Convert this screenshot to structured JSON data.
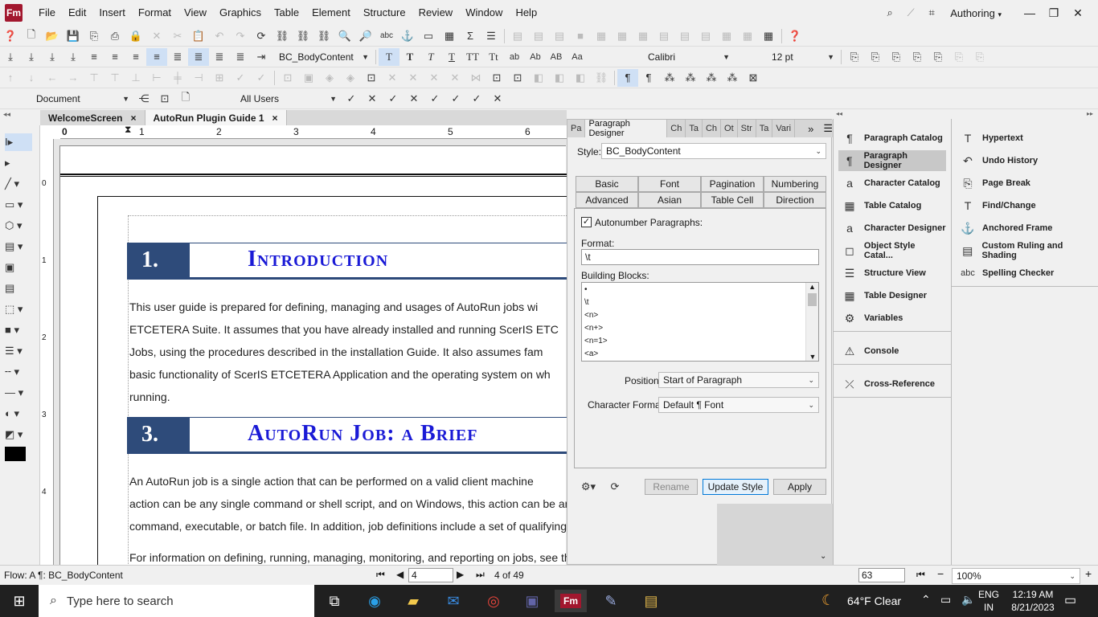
{
  "app": {
    "logo": "Fm",
    "workspace": "Authoring"
  },
  "menu": [
    "File",
    "Edit",
    "Insert",
    "Format",
    "View",
    "Graphics",
    "Table",
    "Element",
    "Structure",
    "Review",
    "Window",
    "Help"
  ],
  "format_toolbar": {
    "paragraph_style": "BC_BodyContent",
    "font": "Calibri",
    "size": "12 pt"
  },
  "track_toolbar": {
    "view": "Document",
    "users": "All Users"
  },
  "doc_tabs": [
    {
      "label": "WelcomeScreen",
      "close": "×"
    },
    {
      "label": "AutoRun Plugin Guide 1",
      "close": "×"
    }
  ],
  "ruler": {
    "h": [
      "0",
      "1",
      "2",
      "3",
      "4",
      "5",
      "6"
    ],
    "v": [
      "0",
      "1",
      "2",
      "3",
      "4"
    ]
  },
  "document": {
    "h1": {
      "num": "1.",
      "title": "Introduction"
    },
    "p1": [
      "This user guide is prepared for defining, managing and usages of AutoRun jobs wi",
      "ETCETERA Suite. It assumes that you have already installed and running ScerIS ETC",
      "Jobs, using the procedures described in the installation Guide. It also assumes fam",
      "basic functionality of ScerIS ETCETERA Application and the operating system on wh",
      "running."
    ],
    "h3": {
      "num": "3.",
      "title": "AutoRun Job: a Brief"
    },
    "p2": [
      "An AutoRun job is a single action that can be performed on a valid client machine",
      "action can be any single command or shell script, and on Windows, this action can be any single",
      "command, executable, or batch file. In addition, job definitions include a set of qualifying attributes."
    ],
    "p3": "For information on defining, running, managing, monitoring, and reporting on jobs, see the corre-"
  },
  "paragraph_designer": {
    "tabs": [
      "Pa",
      "Paragraph Designer",
      "Ch",
      "Ta",
      "Ch",
      "Ot",
      "Str",
      "Ta",
      "Vari"
    ],
    "more": "»",
    "style_label": "Style:",
    "style_value": "BC_BodyContent",
    "subtabs": [
      "Basic",
      "Font",
      "Pagination",
      "Numbering",
      "Advanced",
      "Asian",
      "Table Cell",
      "Direction"
    ],
    "autonumber_label": "Autonumber Paragraphs:",
    "autonumber_checked": true,
    "check_glyph": "✓",
    "format_label": "Format:",
    "format_value": "\\t",
    "building_blocks_label": "Building Blocks:",
    "building_blocks": [
      "•",
      "\\t",
      "<n>",
      "<n+>",
      "<n=1>",
      "<a>"
    ],
    "position_label": "Position:",
    "position_value": "Start of Paragraph",
    "char_format_label": "Character Format:",
    "char_format_value": "Default ¶ Font",
    "buttons": {
      "rename": "Rename",
      "update": "Update Style",
      "apply": "Apply"
    }
  },
  "right_panel_1": [
    {
      "label": "Paragraph Catalog",
      "icon": "¶"
    },
    {
      "label": "Paragraph Designer",
      "icon": "¶",
      "active": true
    },
    {
      "label": "Character Catalog",
      "icon": "a"
    },
    {
      "label": "Table Catalog",
      "icon": "▦"
    },
    {
      "label": "Character Designer",
      "icon": "a"
    },
    {
      "label": "Object Style Catal...",
      "icon": "◻"
    },
    {
      "label": "Structure View",
      "icon": "☰"
    },
    {
      "label": "Table Designer",
      "icon": "▦"
    },
    {
      "label": "Variables",
      "icon": "⚙"
    },
    {
      "label": "Console",
      "icon": "⚠"
    },
    {
      "label": "Cross-Reference",
      "icon": "⤫"
    }
  ],
  "right_panel_2": [
    {
      "label": "Hypertext",
      "icon": "T"
    },
    {
      "label": "Undo History",
      "icon": "↶"
    },
    {
      "label": "Page Break",
      "icon": "⎘"
    },
    {
      "label": "Find/Change",
      "icon": "T"
    },
    {
      "label": "Anchored Frame",
      "icon": "⚓"
    },
    {
      "label": "Custom Ruling and Shading",
      "icon": "▤"
    },
    {
      "label": "Spelling Checker",
      "icon": "abc"
    }
  ],
  "status": {
    "flow": "Flow: A  ¶: BC_BodyContent",
    "page_input": "4",
    "page_info": "4 of 49",
    "zoom_field": "63",
    "zoom": "100%"
  },
  "taskbar": {
    "search_placeholder": "Type here to search",
    "weather": "64°F  Clear",
    "lang1": "ENG",
    "lang2": "IN",
    "time": "12:19 AM",
    "date": "8/21/2023"
  }
}
